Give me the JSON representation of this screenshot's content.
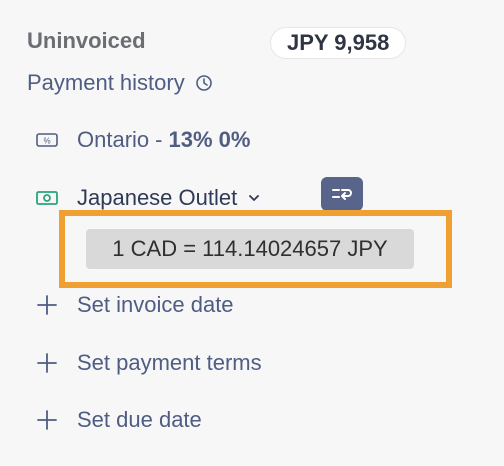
{
  "summary": {
    "uninvoiced_label": "Uninvoiced",
    "uninvoiced_amount": "JPY 9,958"
  },
  "payment_history": {
    "label": "Payment history"
  },
  "tax": {
    "name": "Ontario",
    "separator": "-",
    "rates": "13% 0%"
  },
  "price_list": {
    "name": "Japanese Outlet"
  },
  "exchange_rate": {
    "text": "1 CAD = 114.14024657 JPY"
  },
  "actions": {
    "invoice_date": "Set invoice date",
    "payment_terms": "Set payment terms",
    "due_date": "Set due date"
  },
  "colors": {
    "highlight": "#f0a030",
    "accent": "#59648a",
    "link": "#4f5d82"
  }
}
